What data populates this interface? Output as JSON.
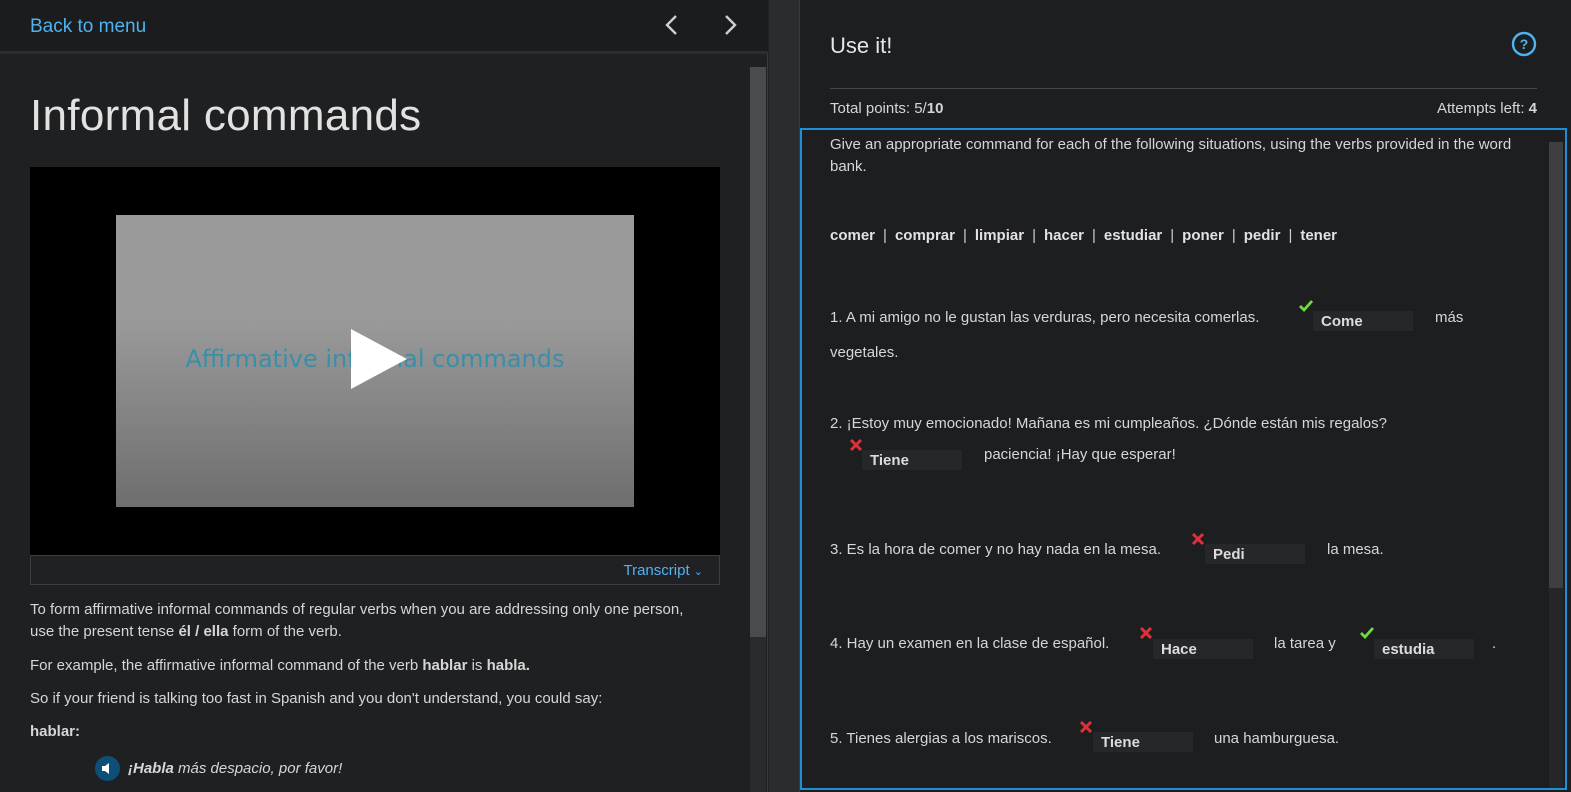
{
  "left": {
    "back_label": "Back to menu",
    "title": "Informal commands",
    "video": {
      "caption": "Affirmative informal commands",
      "transcript_label": "Transcript"
    },
    "paragraphs": [
      "To form affirmative informal commands of regular verbs when you are addressing only one person, use the present tense ",
      "él / ella",
      " form of the verb."
    ],
    "p2": {
      "a": "For example, the affirmative informal command of the verb ",
      "verb": "hablar",
      "b": " is ",
      "cmd": "habla."
    },
    "p3": "So if your friend is talking too fast in Spanish and you don't understand, you could say:",
    "p4": "hablar:",
    "example": {
      "bold": "¡Habla",
      "rest": " más despacio, por favor!"
    }
  },
  "right": {
    "title": "Use it!",
    "points_label": "Total points: 5/",
    "points_total": "10",
    "attempts_label": "Attempts left: ",
    "attempts_value": "4",
    "instructions": "Give an appropriate command for each of the following situations, using the verbs provided in the word bank.",
    "word_bank": [
      "comer",
      "comprar",
      "limpiar",
      "hacer",
      "estudiar",
      "poner",
      "pedir",
      "tener"
    ],
    "q1": {
      "text": "1. A mi amigo no le gustan las verduras, pero necesita comerlas.",
      "answer": "Come",
      "after": "más",
      "line2": "vegetales."
    },
    "q2": {
      "text": "2. ¡Estoy muy emocionado! Mañana es mi cumpleaños. ¿Dónde están mis regalos?",
      "answer": "Tiene",
      "after": "paciencia! ¡Hay que esperar!"
    },
    "q3": {
      "text": "3. Es la hora de comer y no hay nada en la mesa.",
      "answer": "Pedi",
      "after": "la mesa."
    },
    "q4": {
      "text": "4. Hay un examen en la clase de español.",
      "answer1": "Hace",
      "mid": "la tarea y",
      "answer2": "estudia",
      "end": "."
    },
    "q5": {
      "text": "5. Tienes alergias a los mariscos.",
      "answer": "Tiene",
      "after": "una hamburguesa."
    },
    "colors": {
      "accent": "#4fb3f0",
      "correct": "#6fdc3c",
      "wrong": "#e0303a",
      "focus_border": "#1e8fd6"
    }
  }
}
